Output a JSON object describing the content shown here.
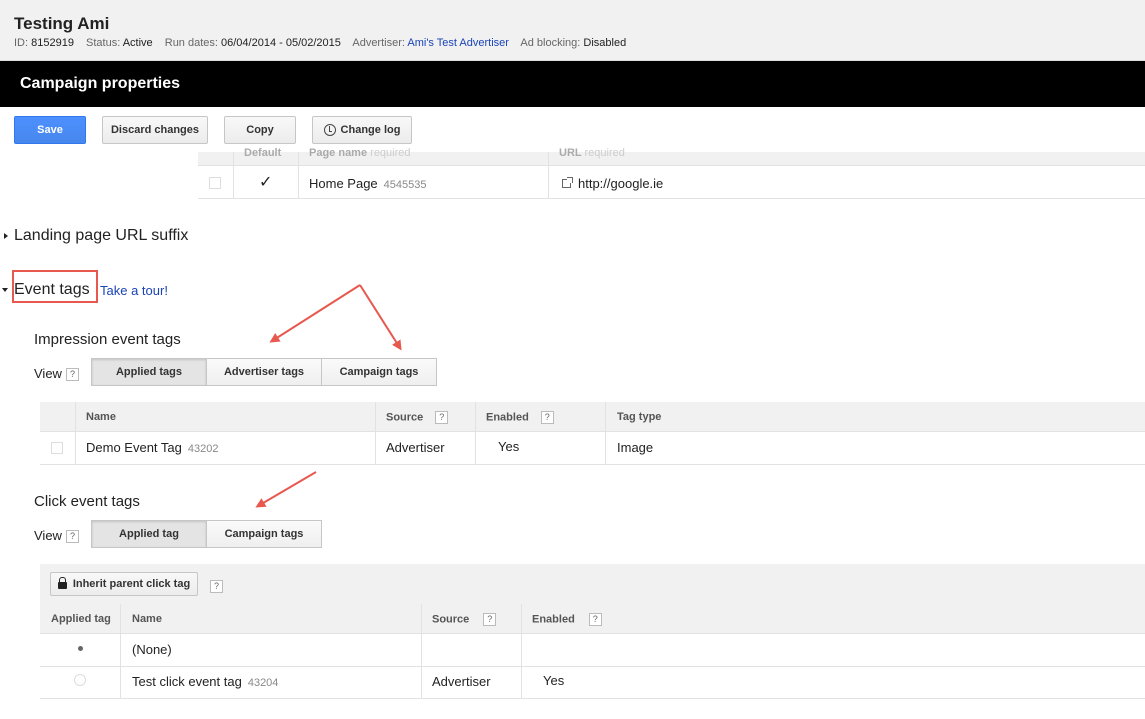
{
  "header": {
    "title": "Testing Ami",
    "id_label": "ID:",
    "id_value": "8152919",
    "status_label": "Status:",
    "status_value": "Active",
    "run_dates_label": "Run dates:",
    "run_dates_value": "06/04/2014 - 05/02/2015",
    "advertiser_label": "Advertiser:",
    "advertiser_value": "Ami's Test Advertiser",
    "ad_blocking_label": "Ad blocking:",
    "ad_blocking_value": "Disabled"
  },
  "page_title": "Campaign properties",
  "toolbar": {
    "save": "Save",
    "discard": "Discard changes",
    "copy": "Copy",
    "change_log": "Change log"
  },
  "landing_pages": {
    "col_default": "Default",
    "col_page_name": "Page name",
    "col_page_name_hint": "required",
    "col_url": "URL",
    "col_url_hint": "required",
    "row": {
      "default_mark": "✓",
      "name": "Home Page",
      "id": "4545535",
      "url": "http://google.ie"
    }
  },
  "url_suffix_section": "Landing page URL suffix",
  "event_tags": {
    "title": "Event tags",
    "tour_link": "Take a tour!",
    "impression": {
      "title": "Impression event tags",
      "view_label": "View",
      "help": "?",
      "tabs": [
        "Applied tags",
        "Advertiser tags",
        "Campaign tags"
      ],
      "columns": {
        "name": "Name",
        "source": "Source",
        "enabled": "Enabled",
        "tag_type": "Tag type"
      },
      "rows": [
        {
          "name": "Demo Event Tag",
          "id": "43202",
          "source": "Advertiser",
          "enabled": "Yes",
          "tag_type": "Image"
        }
      ]
    },
    "click": {
      "title": "Click event tags",
      "view_label": "View",
      "help": "?",
      "tabs": [
        "Applied tag",
        "Campaign tags"
      ],
      "inherit_button": "Inherit parent click tag",
      "columns": {
        "applied": "Applied tag",
        "name": "Name",
        "source": "Source",
        "enabled": "Enabled"
      },
      "rows": [
        {
          "name": "(None)",
          "id": "",
          "source": "",
          "enabled": ""
        },
        {
          "name": "Test click event tag",
          "id": "43204",
          "source": "Advertiser",
          "enabled": "Yes"
        }
      ]
    }
  },
  "colors": {
    "primary_blue": "#4d90fe",
    "link": "#1a44b8",
    "annotation_red": "#e8584f"
  }
}
